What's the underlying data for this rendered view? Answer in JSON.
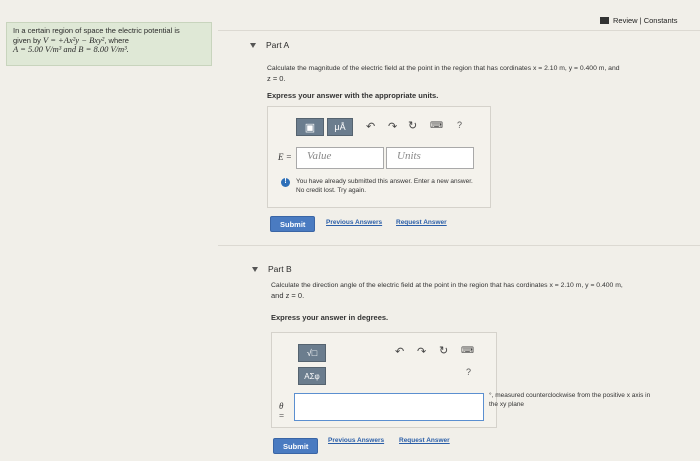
{
  "problem": {
    "line1": "In a certain region of space the electric potential is",
    "line2_prefix": "given by ",
    "formula_v": "V = +Ax²y − Bxy²",
    "line2_suffix": ", where",
    "line3": "A = 5.00 V/m³ and B = 8.00 V/m³."
  },
  "header": {
    "review_label": "Review | Constants"
  },
  "part_a": {
    "title": "Part A",
    "question_line1": "Calculate the magnitude of the electric field at the point in the region that has cordinates x = 2.10 m, y = 0.400 m, and",
    "question_line2": "z = 0.",
    "instruction": "Express your answer with the appropriate units.",
    "toolbar": {
      "mu_label": "μÅ",
      "help_label": "?"
    },
    "var_label": "E =",
    "value_placeholder": "Value",
    "units_placeholder": "Units",
    "notice_line1": "You have already submitted this answer. Enter a new answer.",
    "notice_line2": "No credit lost. Try again.",
    "submit_label": "Submit",
    "prev_answers_label": "Previous Answers",
    "request_answer_label": "Request Answer"
  },
  "part_b": {
    "title": "Part B",
    "question_line1": "Calculate the direction angle of the electric field at the point in the region that has cordinates x = 2.10 m, y = 0.400 m,",
    "question_line2": "and z = 0.",
    "instruction": "Express your answer in degrees.",
    "toolbar": {
      "sqrt_label": "√□",
      "greek_label": "ΑΣφ",
      "help_label": "?"
    },
    "var_label_top": "θ",
    "var_label_bottom": "=",
    "unit_line1": "°, measured counterclockwise from the positive x axis in",
    "unit_line2": "the xy plane",
    "submit_label": "Submit",
    "prev_answers_label": "Previous Answers",
    "request_answer_label": "Request Answer"
  },
  "colors": {
    "problem_bg": "#dfe8d6",
    "toolbar_btn": "#6b7d8e",
    "submit": "#4a7bc1",
    "link": "#2a5ea8",
    "info": "#2d6fb8"
  }
}
